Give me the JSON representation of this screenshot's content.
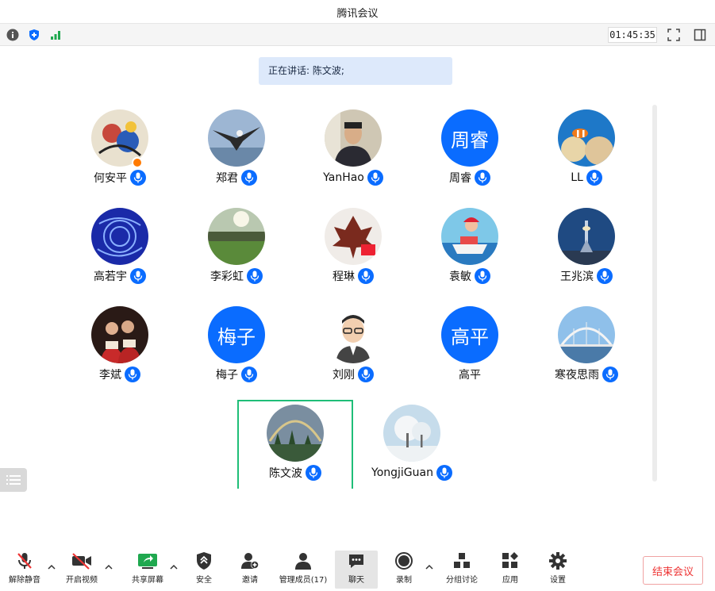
{
  "window": {
    "title": "腾讯会议"
  },
  "status": {
    "timer": "01:45:35"
  },
  "speaking": {
    "text": "正在讲话: 陈文波;"
  },
  "participants": [
    {
      "name": "何安平",
      "mic": true,
      "host": true,
      "avatar": "photo-cartoon"
    },
    {
      "name": "郑君",
      "mic": true,
      "avatar": "photo-eagle"
    },
    {
      "name": "YanHao",
      "mic": true,
      "avatar": "photo-person"
    },
    {
      "name": "周睿",
      "mic": true,
      "avatar_text": "周睿"
    },
    {
      "name": "LL",
      "mic": true,
      "avatar": "photo-coral"
    },
    {
      "name": "高若宇",
      "mic": true,
      "avatar": "photo-blue-pattern"
    },
    {
      "name": "李彩虹",
      "mic": true,
      "avatar": "photo-field"
    },
    {
      "name": "程琳",
      "mic": true,
      "avatar": "photo-leaf"
    },
    {
      "name": "袁敏",
      "mic": true,
      "avatar": "photo-anime"
    },
    {
      "name": "王兆滨",
      "mic": true,
      "avatar": "photo-tower"
    },
    {
      "name": "李斌",
      "mic": true,
      "avatar": "photo-couple"
    },
    {
      "name": "梅子",
      "mic": true,
      "avatar_text": "梅子"
    },
    {
      "name": "刘刚",
      "mic": true,
      "avatar": "photo-cartoon-man"
    },
    {
      "name": "高平",
      "mic": false,
      "avatar_text": "高平"
    },
    {
      "name": "寒夜思雨",
      "mic": true,
      "avatar": "photo-bridge"
    },
    {
      "name": "陈文波",
      "mic": true,
      "active": true,
      "avatar": "photo-rainbow"
    },
    {
      "name": "YongjiGuan",
      "mic": true,
      "avatar": "photo-snow-tree"
    }
  ],
  "toolbar": {
    "unmute": "解除静音",
    "video": "开启视频",
    "share": "共享屏幕",
    "security": "安全",
    "invite": "邀请",
    "members": "管理成员(17)",
    "chat": "聊天",
    "record": "录制",
    "breakout": "分组讨论",
    "apps": "应用",
    "settings": "设置",
    "end": "结束会议"
  },
  "colors": {
    "accent": "#0a6cff",
    "active_border": "#1fbe78",
    "end_red": "#e33333",
    "signal_green": "#1fa84f"
  }
}
